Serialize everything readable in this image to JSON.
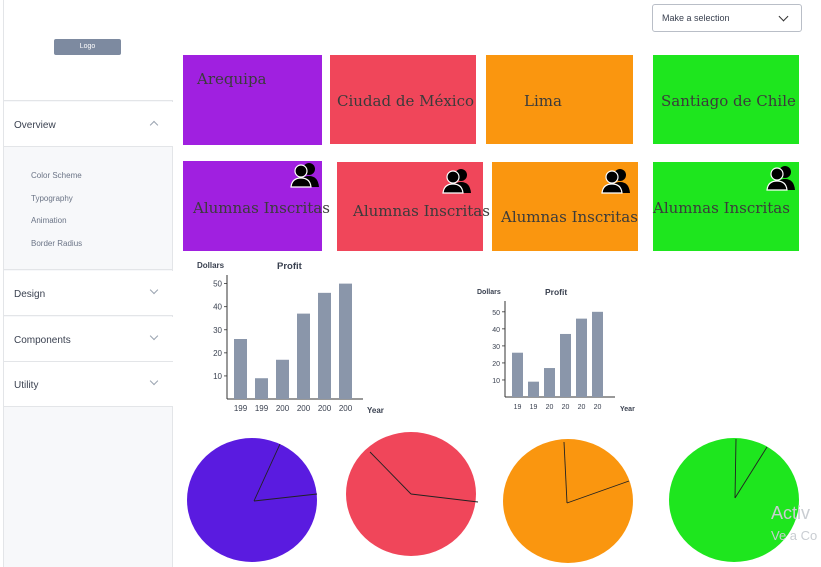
{
  "sidebar": {
    "logo": "Logo",
    "overview": "Overview",
    "sub_items": [
      "Color Scheme",
      "Typography",
      "Animation",
      "Border Radius"
    ],
    "design": "Design",
    "components": "Components",
    "utility": "Utility"
  },
  "select": {
    "label": "Make a selection"
  },
  "city_cards": [
    {
      "name": "Arequipa",
      "color": "#a020e0"
    },
    {
      "name": "Ciudad de México",
      "color": "#f0465a"
    },
    {
      "name": "Lima",
      "color": "#fa960f"
    },
    {
      "name": "Santiago de Chile",
      "color": "#1ee61e"
    }
  ],
  "enrolled_cards": [
    {
      "label": "Alumnas Inscritas",
      "icon": "users-icon",
      "color": "#a020e0"
    },
    {
      "label": "Alumnas Inscritas",
      "icon": "users-icon",
      "color": "#f0465a"
    },
    {
      "label": "Alumnas Inscritas",
      "icon": "users-icon",
      "color": "#fa960f"
    },
    {
      "label": "Alumnas Inscritas",
      "icon": "users-icon",
      "color": "#1ee61e"
    }
  ],
  "chart_data": [
    {
      "type": "bar",
      "title": "Profit",
      "ylabel": "Dollars",
      "xlabel": "Year",
      "categories": [
        "199",
        "199",
        "200",
        "200",
        "200",
        "200"
      ],
      "values": [
        26,
        9,
        17,
        37,
        46,
        50
      ],
      "yticks": [
        10,
        20,
        30,
        40,
        50
      ],
      "ylim": [
        0,
        52
      ],
      "bar_color": "#8a96aa"
    },
    {
      "type": "bar",
      "title": "Profit",
      "ylabel": "Dollars",
      "xlabel": "Year",
      "categories": [
        "19",
        "19",
        "20",
        "20",
        "20",
        "20"
      ],
      "values": [
        26,
        9,
        17,
        37,
        46,
        50
      ],
      "yticks": [
        10,
        20,
        30,
        40,
        50
      ],
      "ylim": [
        0,
        54
      ],
      "bar_color": "#8a96aa"
    }
  ],
  "pies": [
    {
      "color": "#5a1be0"
    },
    {
      "color": "#f0465a"
    },
    {
      "color": "#fa960f"
    },
    {
      "color": "#1ee61e"
    }
  ],
  "watermark": {
    "line1": "Activ",
    "line2": "Ve a Co"
  }
}
